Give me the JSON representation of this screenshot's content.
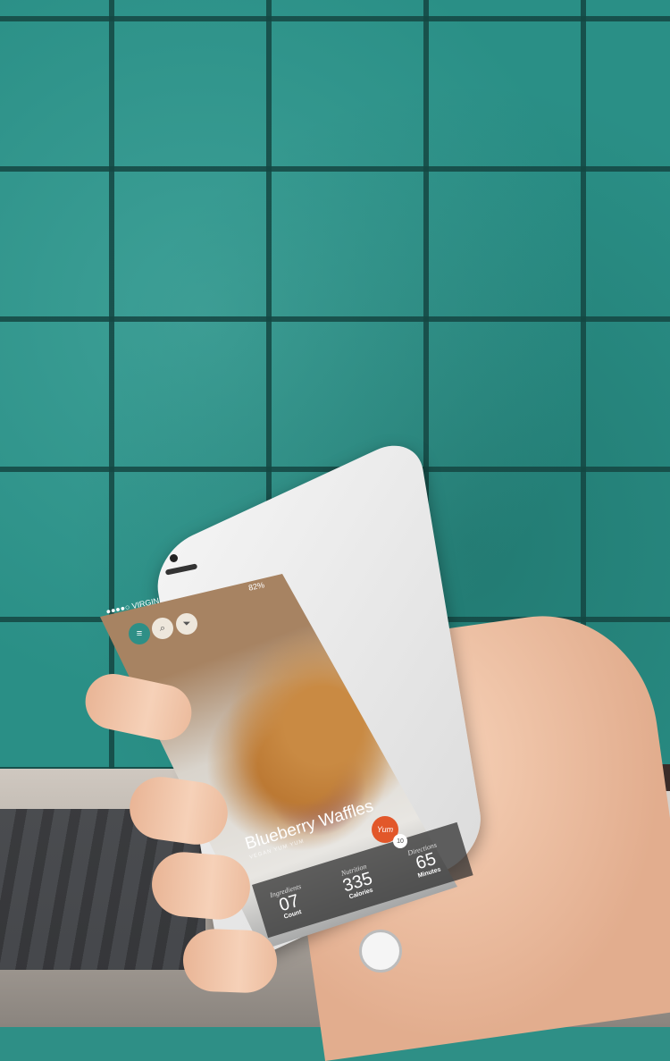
{
  "status_bar": {
    "carrier": "●●●●○ VIRGIN",
    "battery": "82%"
  },
  "nav": {
    "menu_icon": "menu-icon",
    "search_icon": "search-icon",
    "filter_icon": "filter-icon"
  },
  "recipe": {
    "title": "Blueberry Waffles",
    "subtitle": "VEGAN YUM YUM"
  },
  "yum_badge": {
    "label": "Yum",
    "count": "10"
  },
  "stats": [
    {
      "label": "Ingredients",
      "value": "07",
      "unit": "Count"
    },
    {
      "label": "Nutrition",
      "value": "335",
      "unit": "Calories"
    },
    {
      "label": "Directions",
      "value": "65",
      "unit": "Minutes"
    }
  ],
  "colors": {
    "accent": "#2e8f86",
    "yum": "#e2572a"
  }
}
